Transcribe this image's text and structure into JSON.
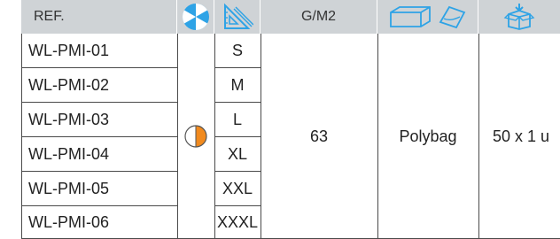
{
  "header": {
    "ref_label": "REF.",
    "gsm_label": "G/M2",
    "color_icon": "color-wheel-icon",
    "size_icon": "set-square-ruler-icon",
    "packaging_icons": [
      "box-icon",
      "bag-icon"
    ],
    "carton_icon": "carton-box-icon"
  },
  "rows": [
    {
      "ref": "WL-PMI-01",
      "size": "S"
    },
    {
      "ref": "WL-PMI-02",
      "size": "M"
    },
    {
      "ref": "WL-PMI-03",
      "size": "L"
    },
    {
      "ref": "WL-PMI-04",
      "size": "XL"
    },
    {
      "ref": "WL-PMI-05",
      "size": "XXL"
    },
    {
      "ref": "WL-PMI-06",
      "size": "XXXL"
    }
  ],
  "shared": {
    "color_swatch": "white-orange-half-circle",
    "gsm": "63",
    "packaging": "Polybag",
    "carton": "50 x 1 u"
  },
  "colors": {
    "header_bg": "#cfd3d6",
    "accent_blue": "#2ea3e6",
    "accent_orange": "#f18a1e",
    "grid_line": "#4a4a4a"
  }
}
